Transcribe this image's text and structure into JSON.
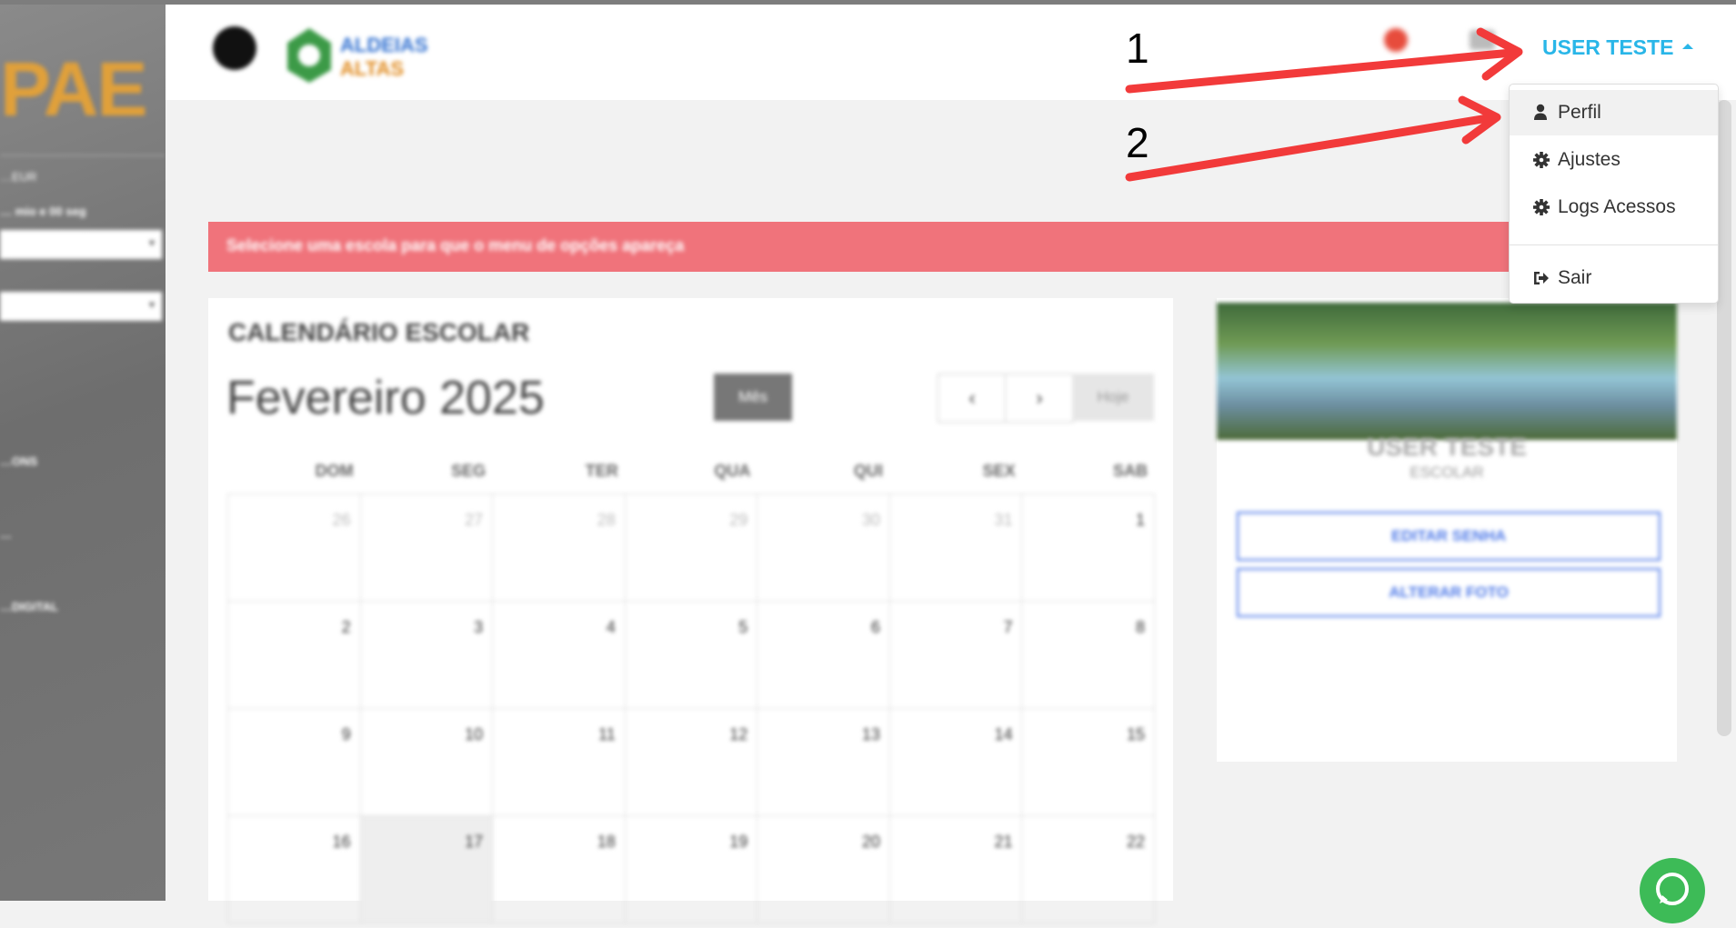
{
  "sidebar": {
    "logo_text": "PAE",
    "line1": "…EUR",
    "line2": "… mio e 00 seg",
    "items": [
      "…ONS",
      "…",
      "…DIGITAL"
    ]
  },
  "header": {
    "user_name": "USER TESTE",
    "logo_line1": "ALDEIAS",
    "logo_line2": "ALTAS"
  },
  "alert": {
    "text": "Selecione uma escola para que o menu de opções apareça"
  },
  "calendar": {
    "title": "CALENDÁRIO ESCOLAR",
    "month_label": "Fevereiro 2025",
    "view_button": "Mês",
    "prev_icon": "‹",
    "next_icon": "›",
    "today_button": "Hoje",
    "weekdays": [
      "DOM",
      "SEG",
      "TER",
      "QUA",
      "QUI",
      "SEX",
      "SAB"
    ],
    "weeks": [
      [
        "26",
        "27",
        "28",
        "29",
        "30",
        "31",
        "1"
      ],
      [
        "2",
        "3",
        "4",
        "5",
        "6",
        "7",
        "8"
      ],
      [
        "9",
        "10",
        "11",
        "12",
        "13",
        "14",
        "15"
      ],
      [
        "16",
        "17",
        "18",
        "19",
        "20",
        "21",
        "22"
      ]
    ]
  },
  "profile": {
    "name": "USER TESTE",
    "role": "ESCOLAR",
    "edit_password": "EDITAR SENHA",
    "change_photo": "ALTERAR FOTO"
  },
  "dropdown": {
    "items": [
      {
        "label": "Perfil",
        "icon": "user-icon"
      },
      {
        "label": "Ajustes",
        "icon": "gear-icon"
      },
      {
        "label": "Logs Acessos",
        "icon": "gear-icon"
      },
      {
        "label": "Sair",
        "icon": "sign-out-icon"
      }
    ]
  },
  "annotations": {
    "marker1": "1",
    "marker2": "2",
    "arrow_color": "#f23a3a"
  },
  "colors": {
    "accent": "#29b6e8",
    "alert": "#f0737b",
    "whatsapp": "#3dbb57"
  }
}
